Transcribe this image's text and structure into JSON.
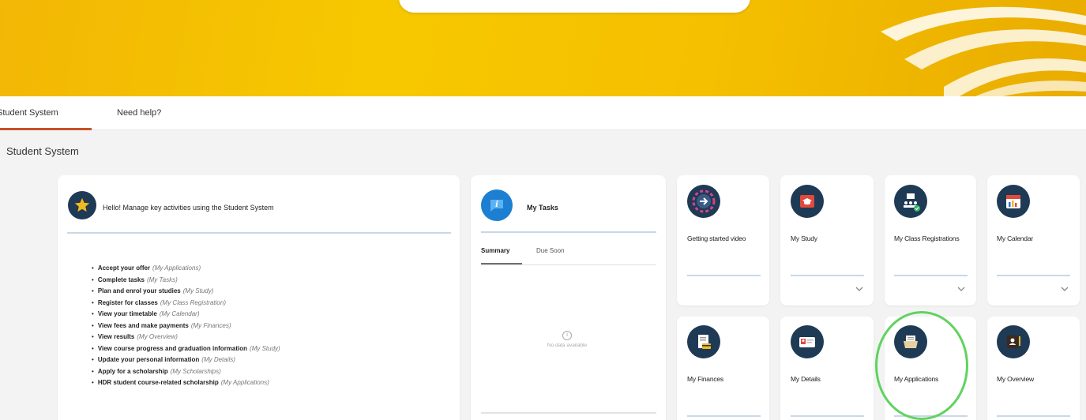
{
  "nav": {
    "tabs": [
      {
        "label": "Student System"
      },
      {
        "label": "Need help?"
      }
    ]
  },
  "page": {
    "title": "Student System"
  },
  "hello": {
    "title": "Hello! Manage key activities using the Student System",
    "activities": [
      {
        "action": "Accept your offer",
        "hint": "(My Applications)"
      },
      {
        "action": "Complete tasks",
        "hint": "(My Tasks)"
      },
      {
        "action": "Plan and enrol your studies",
        "hint": "(My Study)"
      },
      {
        "action": "Register for classes",
        "hint": "(My Class Registration)"
      },
      {
        "action": "View your timetable",
        "hint": "(My Calendar)"
      },
      {
        "action": "View fees and make payments",
        "hint": "(My Finances)"
      },
      {
        "action": "View results",
        "hint": "(My Overview)"
      },
      {
        "action": "View course progress and graduation information",
        "hint": "(My Study)"
      },
      {
        "action": "Update your personal information",
        "hint": "(My Details)"
      },
      {
        "action": "Apply for a scholarship",
        "hint": "(My Scholarships)"
      },
      {
        "action": "HDR student course-related scholarship",
        "hint": "(My Applications)"
      }
    ]
  },
  "tasks": {
    "title": "My Tasks",
    "tabs": {
      "summary": "Summary",
      "due_soon": "Due Soon"
    },
    "empty_text": "No data available"
  },
  "tiles": {
    "getting_started": "Getting started video",
    "my_study": "My Study",
    "my_class_registrations": "My Class Registrations",
    "my_calendar": "My Calendar",
    "my_finances": "My Finances",
    "my_details": "My Details",
    "my_applications": "My Applications",
    "my_overview": "My Overview"
  },
  "colors": {
    "banner": "#f5c000",
    "nav_active": "#c8512a",
    "icon_navy": "#1f3a55",
    "highlight": "#5fd35f",
    "divider": "#c7d8ea"
  }
}
